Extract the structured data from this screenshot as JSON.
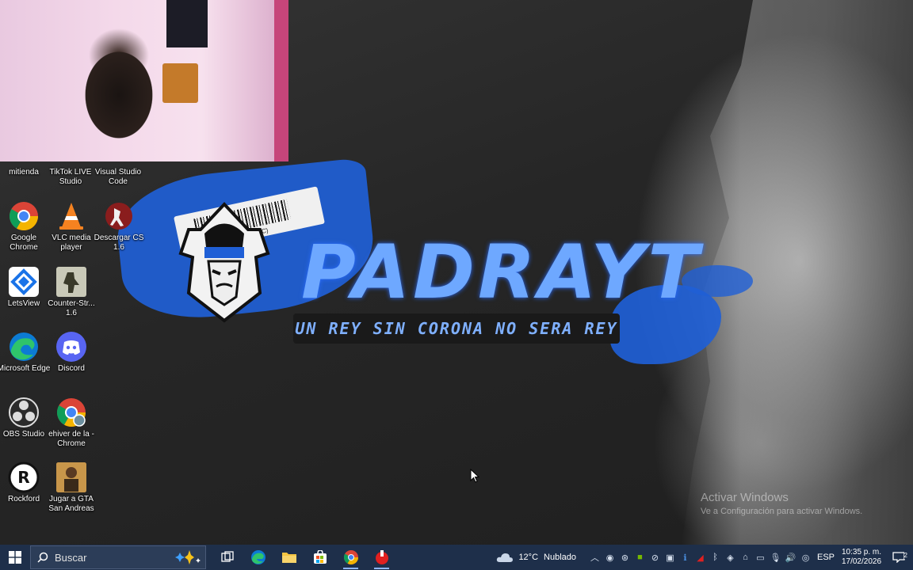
{
  "desktop": {
    "wallpaper": {
      "title": "PADRAYT",
      "slogan": "UN REY SIN CORONA NO SERA REY",
      "barcode_text": "56B-789(C)"
    },
    "icons": [
      {
        "label": "mitienda"
      },
      {
        "label": "TikTok LIVE Studio"
      },
      {
        "label": "Visual Studio Code"
      },
      {
        "label": "Google Chrome"
      },
      {
        "label": "VLC media player"
      },
      {
        "label": "Descargar CS 1.6"
      },
      {
        "label": "LetsView"
      },
      {
        "label": "Counter-Str... 1.6"
      },
      {
        "label": "Microsoft Edge"
      },
      {
        "label": "Discord"
      },
      {
        "label": "OBS Studio"
      },
      {
        "label": "ehiver de la - Chrome"
      },
      {
        "label": "Rockford"
      },
      {
        "label": "Jugar a GTA San Andreas"
      }
    ],
    "watermark": {
      "title": "Activar Windows",
      "subtitle": "Ve a Configuración para activar Windows."
    }
  },
  "taskbar": {
    "search_placeholder": "Buscar",
    "weather": {
      "temp": "12°C",
      "condition": "Nublado"
    },
    "language": "ESP",
    "clock": {
      "time": "10:35 p. m.",
      "date": "17/02/2026"
    },
    "notification_count": "2",
    "colors": {
      "bar": "#1e2f4a",
      "accent": "#8fb6ff"
    }
  }
}
